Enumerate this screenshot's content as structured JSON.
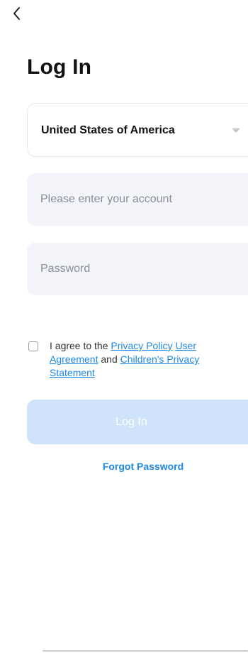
{
  "header": {
    "back_icon": "chevron-left-icon",
    "title": "Log In"
  },
  "form": {
    "country": {
      "value": "United States of America",
      "icon": "triangle-down-icon"
    },
    "account": {
      "placeholder": "Please enter your account",
      "value": ""
    },
    "password": {
      "placeholder": "Password",
      "value": ""
    },
    "agreement": {
      "checked": false,
      "prefix": "I agree to the",
      "privacy_policy": "Privacy Policy",
      "user_agreement": "User Agreement",
      "and_text": "and",
      "childrens_privacy": "Children's Privacy Statement"
    },
    "login_button": "Log In",
    "forgot_password": "Forgot Password"
  },
  "colors": {
    "link": "#1e88e5",
    "login_button_disabled": "#cfe3fb",
    "field_background": "#f4f5fb"
  }
}
